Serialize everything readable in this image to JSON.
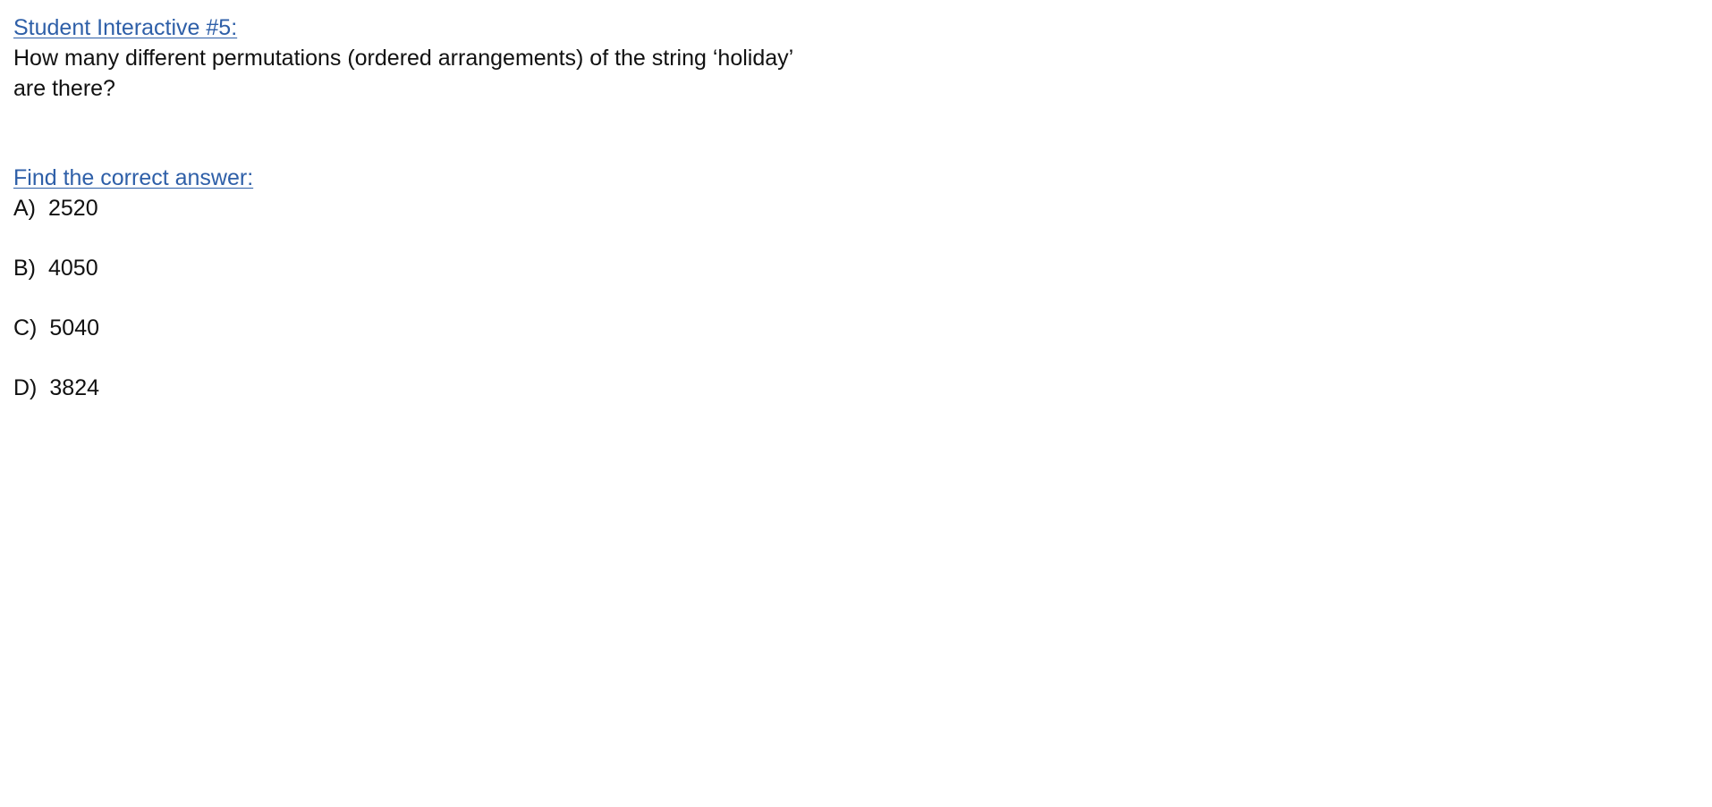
{
  "title": "Student Interactive #5:",
  "question_line1": "How many different permutations (ordered arrangements) of the string ‘holiday’",
  "question_line2": "are there?",
  "answer_heading": "Find the correct answer:",
  "options": [
    {
      "letter": "A)",
      "value": "2520"
    },
    {
      "letter": "B)",
      "value": "4050"
    },
    {
      "letter": "C)",
      "value": "5040"
    },
    {
      "letter": "D)",
      "value": "3824"
    }
  ],
  "colors": {
    "heading": "#2e5fa8",
    "text": "#111111",
    "background": "#ffffff"
  }
}
